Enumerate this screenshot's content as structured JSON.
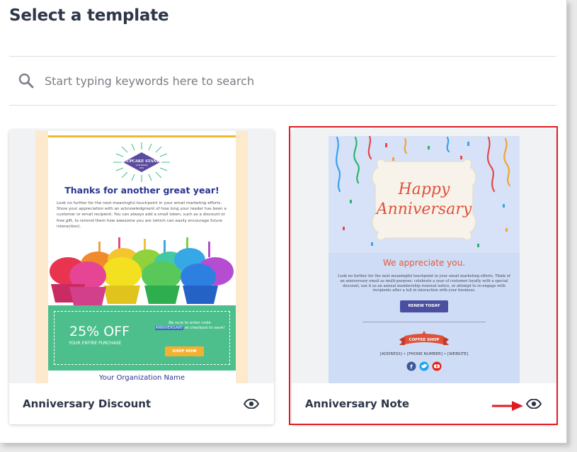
{
  "page": {
    "title": "Select a template"
  },
  "search": {
    "placeholder": "Start typing keywords here to search"
  },
  "colors": {
    "accent": "#283593",
    "highlight": "#e01b24"
  },
  "templates": [
    {
      "name": "Anniversary Discount",
      "preview": {
        "logo_text": "CUPCAKE STAND",
        "logo_subtext": "YOUR BRAND",
        "logo_year": "2019",
        "heading": "Thanks for another great year!",
        "body": "Look no further for the next meaningful touchpoint in your email marketing efforts. Show your appreciation with an acknowledgment of how long your reader has been a customer or email recipient. You can always add a small token, such as a discount or free gift, to remind them how awesome you are (which can easily encourage future interaction).",
        "promo_big": "25% OFF",
        "promo_sub": "YOUR ENTIRE PURCHASE",
        "promo_code_before": "Be sure to enter code",
        "promo_code": "ANNIVERSARY",
        "promo_code_after": "at checkout to save!",
        "button": "SHOP NOW",
        "org": "Your Organization Name"
      }
    },
    {
      "name": "Anniversary Note",
      "preview": {
        "script_line1": "Happy",
        "script_line2": "Anniversary",
        "heading": "We appreciate you.",
        "body": "Look no further for the next meaningful touchpoint in your email marketing efforts. Think of an anniversary email as multi-purpose: celebrate a year of customer loyalty with a special discount, use it as an annual membership renewal notice, or attempt to re-engage with recipients after a lull in interaction with your business.",
        "button": "RENEW TODAY",
        "shop_label": "COFFEE SHOP",
        "address": "[ADDRESS]  •  [PHONE NUMBER]  •  [WEBSITE]"
      }
    }
  ],
  "icons": {
    "search": "search-icon",
    "preview": "eye-icon",
    "pointer": "red-arrow-icon"
  }
}
